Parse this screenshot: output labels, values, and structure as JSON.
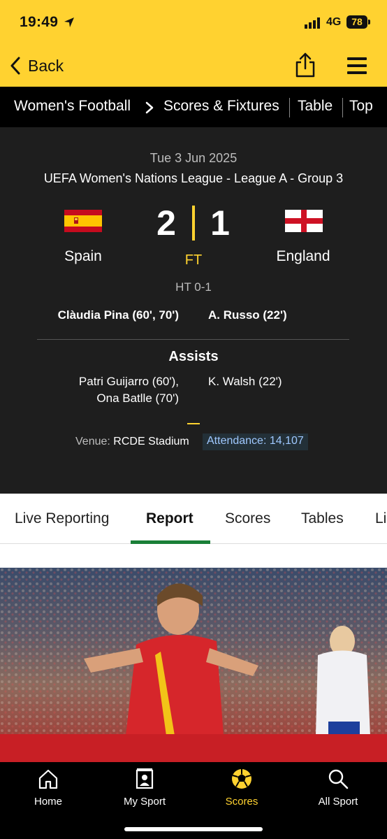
{
  "status_bar": {
    "time": "19:49",
    "network": "4G",
    "battery": "78",
    "icons": [
      "location-arrow-icon",
      "signal-icon"
    ]
  },
  "header": {
    "back_label": "Back",
    "share_icon": "share-icon",
    "menu_icon": "hamburger-menu-icon",
    "accent_color": "#ffd230"
  },
  "breadcrumbs": {
    "items": [
      "Women's Football",
      "Scores & Fixtures",
      "Table",
      "Top"
    ]
  },
  "match": {
    "date": "Tue 3 Jun 2025",
    "competition": "UEFA Women's Nations League - League A - Group 3",
    "home": {
      "name": "Spain",
      "score": "2",
      "flag": "spain-flag"
    },
    "away": {
      "name": "England",
      "score": "1",
      "flag": "england-flag"
    },
    "status": "FT",
    "half_time": "HT 0-1",
    "scorers_home": "Clàudia Pina (60', 70')",
    "scorers_away": "A. Russo (22')",
    "assists_title": "Assists",
    "assists_home": [
      "Patri Guijarro (60'),",
      "Ona Batlle (70')"
    ],
    "assists_away": [
      "K. Walsh (22')"
    ],
    "venue_label": "Venue:",
    "venue_value": "RCDE Stadium",
    "attendance_label": "Attendance:",
    "attendance_value": "14,107"
  },
  "tabs": {
    "items": [
      "Live Reporting",
      "Report",
      "Scores",
      "Tables",
      "Li"
    ],
    "active": "Report"
  },
  "bottom_nav": {
    "items": [
      {
        "label": "Home",
        "icon": "home-icon"
      },
      {
        "label": "My Sport",
        "icon": "my-sport-icon"
      },
      {
        "label": "Scores",
        "icon": "football-icon"
      },
      {
        "label": "All Sport",
        "icon": "search-icon"
      }
    ],
    "active": "Scores"
  }
}
